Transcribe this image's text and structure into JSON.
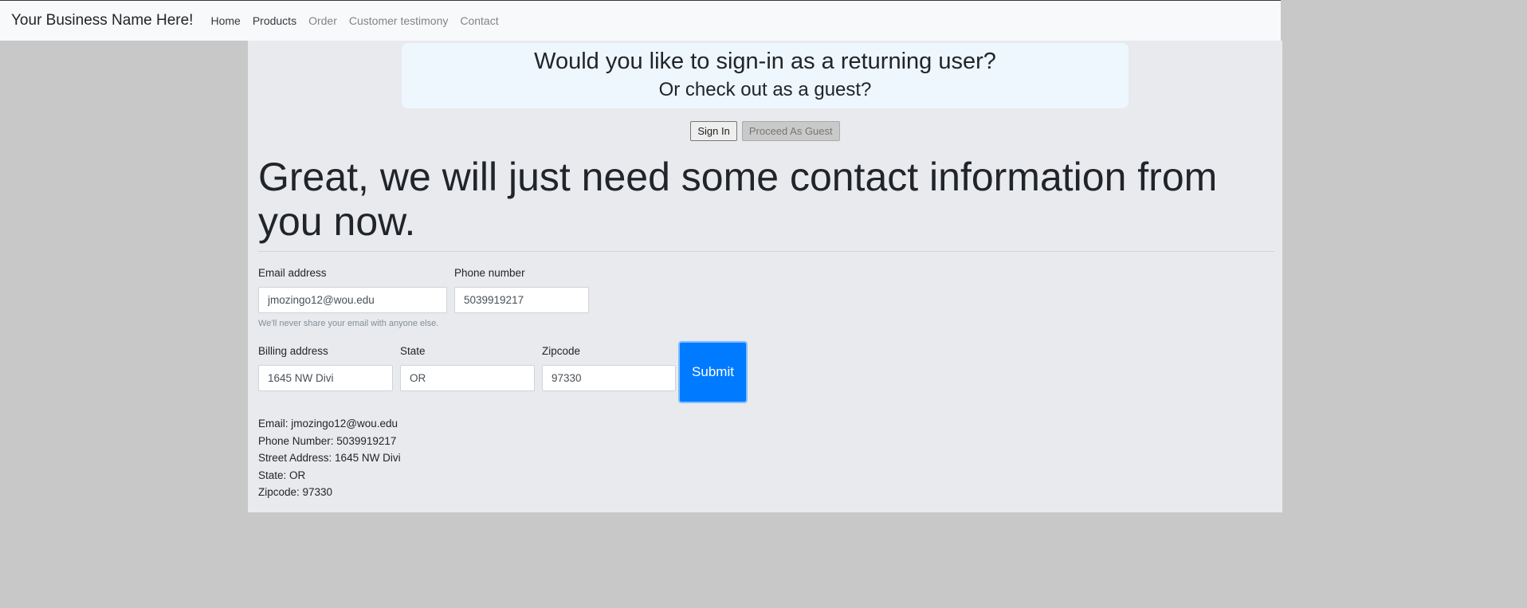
{
  "navbar": {
    "brand": "Your Business Name Here!",
    "links": [
      {
        "label": "Home"
      },
      {
        "label": "Products"
      },
      {
        "label": "Order"
      },
      {
        "label": "Customer testimony"
      },
      {
        "label": "Contact"
      }
    ]
  },
  "signin_prompt": {
    "line1": "Would you like to sign-in as a returning user?",
    "line2": "Or check out as a guest?",
    "sign_in_label": "Sign In",
    "guest_label": "Proceed As Guest"
  },
  "headline": "Great, we will just need some contact information from you now.",
  "form": {
    "email_label": "Email address",
    "email_value": "jmozingo12@wou.edu",
    "phone_label": "Phone number",
    "phone_value": "5039919217",
    "email_help": "We'll never share your email with anyone else.",
    "billing_label": "Billing address",
    "billing_value": "1645 NW Divi",
    "state_label": "State",
    "state_value": "OR",
    "zip_label": "Zipcode",
    "zip_value": "97330",
    "submit_label": "Submit"
  },
  "summary": {
    "email": "Email: jmozingo12@wou.edu",
    "phone": "Phone Number: 5039919217",
    "street": "Street Address: 1645 NW Divi",
    "state": "State: OR",
    "zip": "Zipcode: 97330"
  },
  "colors": {
    "page_background": "#c8c8c8",
    "navbar_background": "#f8f9fa",
    "container_background": "#e8eaed",
    "callout_background": "#eef6fe",
    "submit_background": "#007bff"
  }
}
